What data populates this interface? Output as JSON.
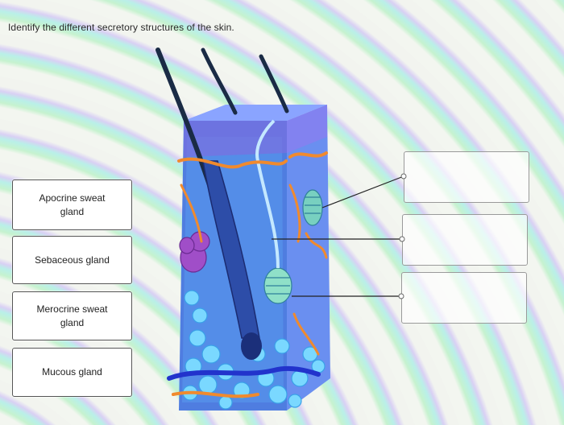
{
  "question": "Identify the different secretory structures of the skin.",
  "answer_choices": [
    {
      "label_line1": "Apocrine sweat",
      "label_line2": "gland"
    },
    {
      "label_line1": "Sebaceous gland",
      "label_line2": ""
    },
    {
      "label_line1": "Merocrine sweat",
      "label_line2": "gland"
    },
    {
      "label_line1": "Mucous gland",
      "label_line2": ""
    }
  ],
  "drop_targets": [
    {
      "value": ""
    },
    {
      "value": ""
    },
    {
      "value": ""
    }
  ],
  "colors": {
    "epidermis": "#6f8fe6",
    "dermis": "#5a86e0",
    "hair": "#1a2b45",
    "vessel_orange": "#f08a2e",
    "vessel_blue": "#2233cc",
    "gland": "#6fd6c0"
  }
}
